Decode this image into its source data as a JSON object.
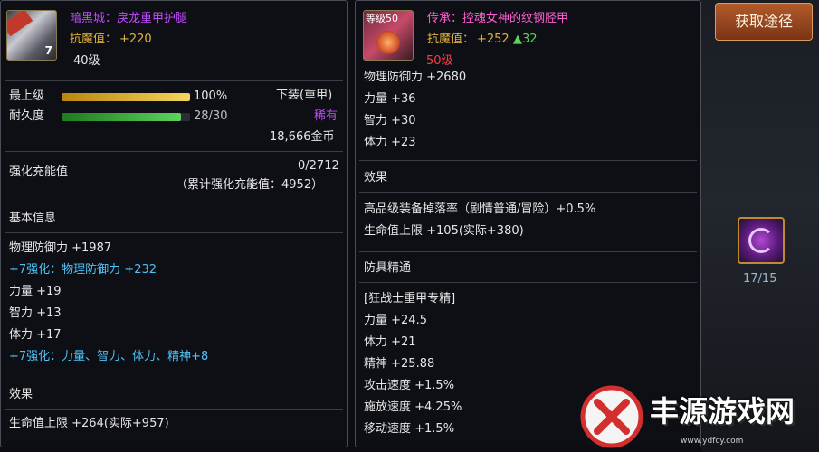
{
  "left_item": {
    "badge": "7",
    "name": "暗黑城：戾龙重甲护腿",
    "resist_label": "抗魔值：",
    "resist_value": "+220",
    "level": "40级",
    "stats": {
      "max_level_label": "最上级",
      "max_level_value": "100%",
      "max_level_fill": 1.0,
      "durability_label": "耐久度",
      "durability_value": "28/30",
      "durability_fill": 0.933,
      "slot": "下装(重甲)",
      "rarity": "稀有",
      "price": "18,666金币"
    },
    "reinforce": {
      "label": "强化充能值",
      "value": "0/2712",
      "cumulative": "（累计强化充能值：4952）"
    },
    "basic_title": "基本信息",
    "basic_lines": [
      {
        "text": "物理防御力 +1987",
        "color": "#e6e6e6"
      },
      {
        "text": "+7强化：物理防御力 +232",
        "color": "#4fc3f7"
      },
      {
        "text": "力量 +19",
        "color": "#e6e6e6"
      },
      {
        "text": "智力 +13",
        "color": "#e6e6e6"
      },
      {
        "text": "体力 +17",
        "color": "#e6e6e6"
      },
      {
        "text": "+7强化：力量、智力、体力、精神+8",
        "color": "#4fc3f7"
      }
    ],
    "effect_title": "效果",
    "effect_lines": [
      "生命值上限 +264(实际+957)"
    ]
  },
  "right_item": {
    "badge": "等级50",
    "name": "传承：控魂女神的纹钢胫甲",
    "resist_label": "抗魔值：",
    "resist_value": "+252",
    "resist_delta": "▲32",
    "level": "50级",
    "stats_lines": [
      "物理防御力 +2680",
      "力量 +36",
      "智力 +30",
      "体力 +23"
    ],
    "effect_title": "效果",
    "effect_lines": [
      "高品级装备掉落率（剧情普通/冒险）+0.5%",
      "生命值上限 +105(实际+380)"
    ],
    "mastery_title": "防具精通",
    "mastery_lines": [
      "[狂战士重甲专精]",
      "力量 +24.5",
      "体力 +21",
      "精神 +25.88",
      "攻击速度 +1.5%",
      "施放速度 +4.25%",
      "移动速度 +1.5%"
    ]
  },
  "side": {
    "source_button": "获取途径",
    "skill_count": "17/15",
    "watermark_text": "丰源游戏网",
    "watermark_url": "www.ydfcy.com"
  },
  "colors": {
    "gold": "#e3b33c",
    "purple": "#c24bff",
    "magenta": "#ff5fd2",
    "red": "#ff3b3b",
    "green": "#5cd35c",
    "cyan": "#4fc3f7",
    "section": "#c9b98a"
  }
}
